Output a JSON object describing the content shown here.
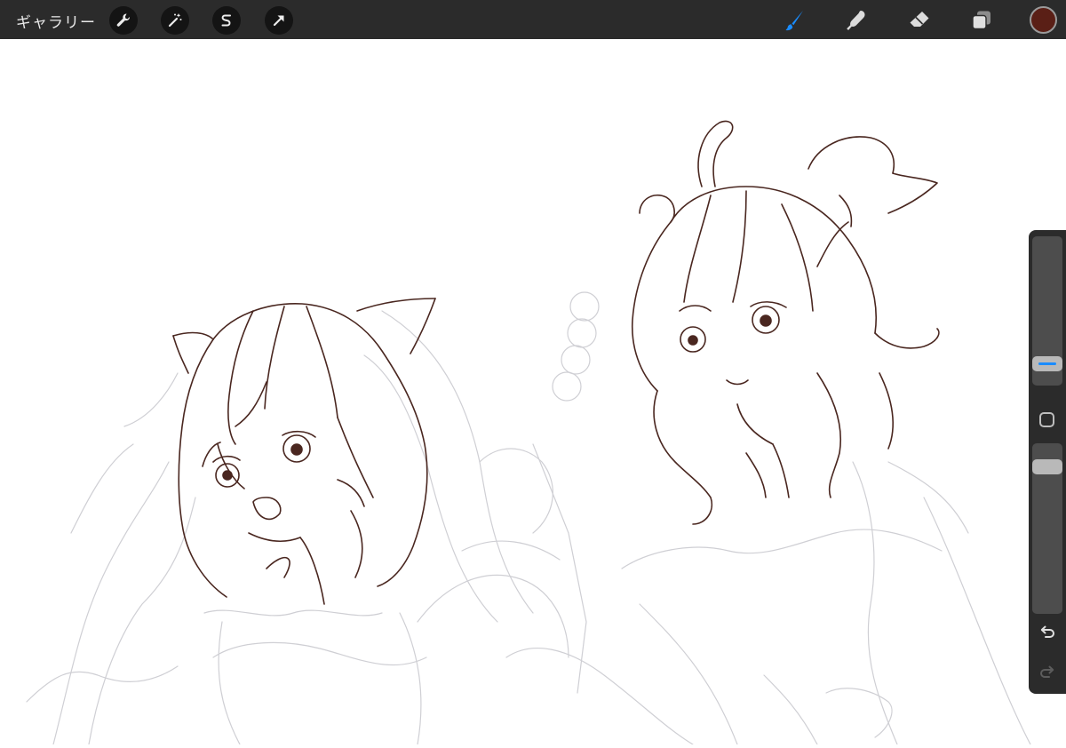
{
  "toolbar": {
    "gallery_label": "ギャラリー",
    "left_tools": [
      {
        "name": "actions",
        "icon": "wrench-icon"
      },
      {
        "name": "adjustments",
        "icon": "magic-wand-icon"
      },
      {
        "name": "selection",
        "icon": "selection-s-icon"
      },
      {
        "name": "transform",
        "icon": "arrow-cursor-icon"
      }
    ],
    "right_tools": [
      {
        "name": "brush",
        "icon": "brush-icon",
        "active": true
      },
      {
        "name": "smudge",
        "icon": "smudge-finger-icon"
      },
      {
        "name": "eraser",
        "icon": "eraser-icon"
      },
      {
        "name": "layers",
        "icon": "layers-icon"
      }
    ],
    "current_color": "#5a1f16",
    "accent_color": "#1a8cff"
  },
  "sidebar": {
    "brush_size_level": 0.2,
    "brush_opacity_level": 0.9,
    "undo_icon": "undo-arrow-icon",
    "redo_icon": "redo-arrow-icon"
  }
}
